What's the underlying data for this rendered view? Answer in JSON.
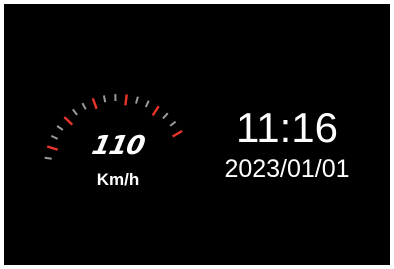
{
  "speedometer": {
    "speed_value": "110",
    "unit": "Km/h",
    "tick_colors": {
      "minor": "#9a9a9a",
      "major": "#e8352a"
    }
  },
  "clock": {
    "time": "11:16",
    "date": "2023/01/01"
  }
}
